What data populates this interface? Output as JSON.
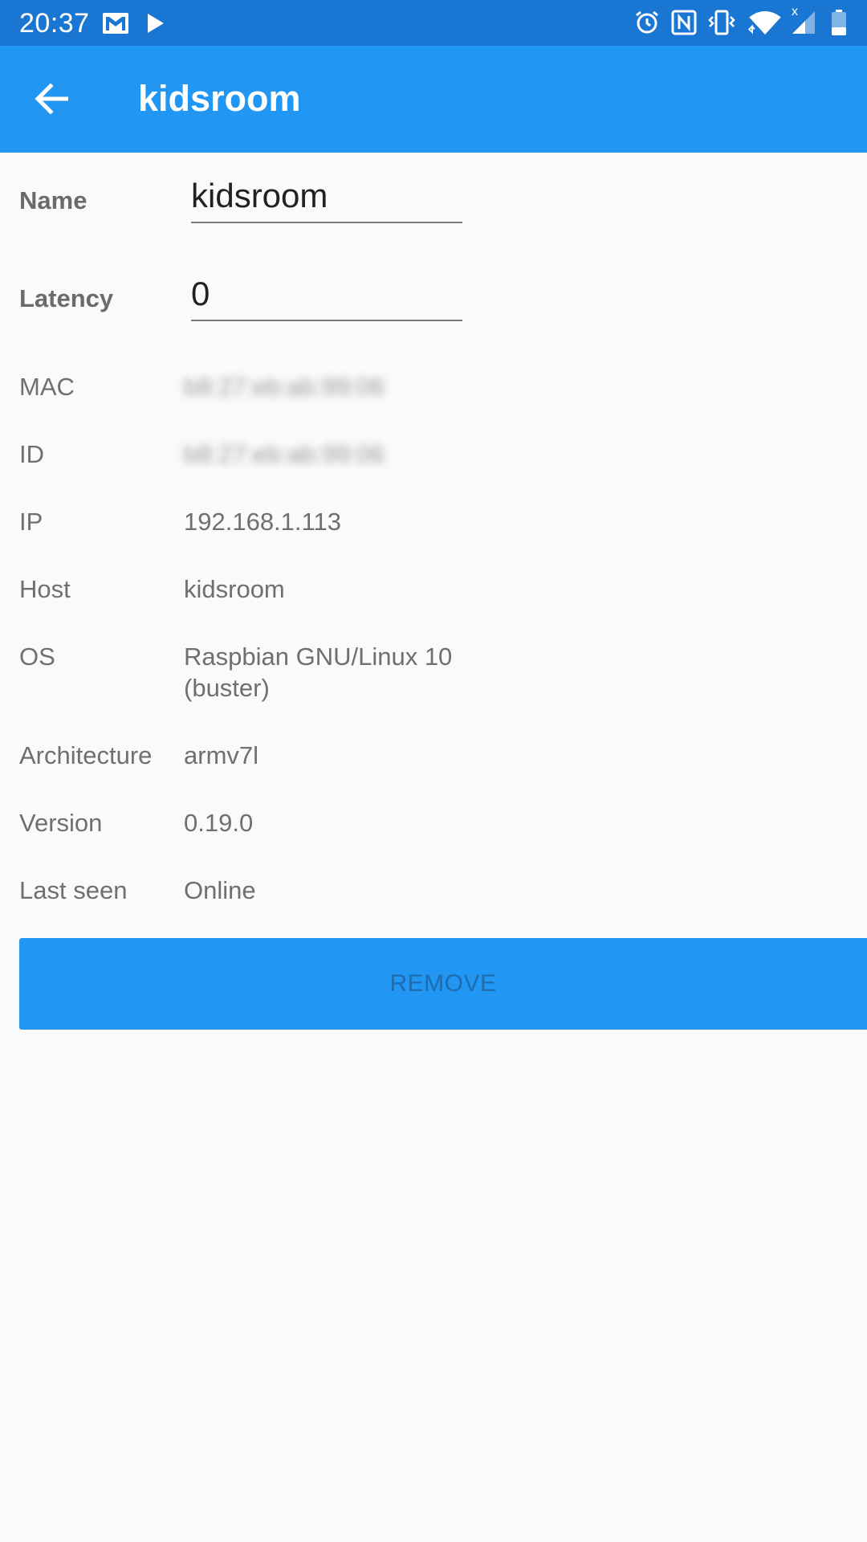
{
  "status_bar": {
    "time": "20:37",
    "left_icons": [
      "gmail-icon",
      "play-store-icon"
    ],
    "right_icons": [
      "alarm-icon",
      "nfc-icon",
      "vibrate-icon",
      "wifi-icon",
      "signal-icon",
      "battery-icon"
    ],
    "signal_badge": "x"
  },
  "app_bar": {
    "title": "kidsroom",
    "back_icon": "arrow-back-icon"
  },
  "form": {
    "name": {
      "label": "Name",
      "value": "kidsroom"
    },
    "latency": {
      "label": "Latency",
      "value": "0"
    }
  },
  "info": {
    "mac": {
      "label": "MAC",
      "value": "b8:27:eb:ab:99:06"
    },
    "id": {
      "label": "ID",
      "value": "b8:27:eb:ab:99:06"
    },
    "ip": {
      "label": "IP",
      "value": "192.168.1.113"
    },
    "host": {
      "label": "Host",
      "value": "kidsroom"
    },
    "os": {
      "label": "OS",
      "value_line1": "Raspbian GNU/Linux 10",
      "value_line2": "(buster)"
    },
    "architecture": {
      "label": "Architecture",
      "value": "armv7l"
    },
    "version": {
      "label": "Version",
      "value": "0.19.0"
    },
    "last_seen": {
      "label": "Last seen",
      "value": "Online"
    }
  },
  "actions": {
    "remove_label": "REMOVE"
  },
  "colors": {
    "status_bar": "#1976d2",
    "app_bar": "#2196f3",
    "button": "#2196f3",
    "button_text": "#1e6db0",
    "background": "#fafafa"
  }
}
